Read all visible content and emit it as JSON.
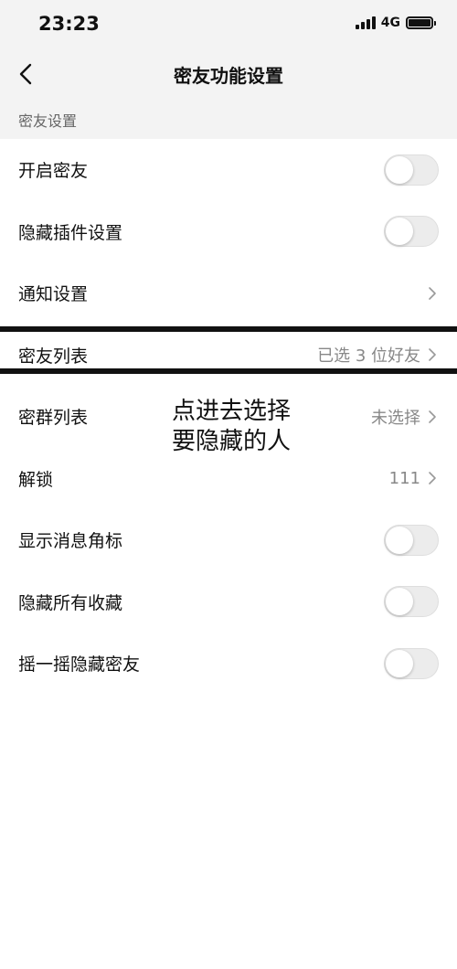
{
  "status_bar": {
    "time": "23:23",
    "network": "4G"
  },
  "nav": {
    "title": "密友功能设置"
  },
  "section": {
    "title": "密友设置"
  },
  "rows": [
    {
      "label": "开启密友",
      "type": "toggle",
      "on": false
    },
    {
      "label": "隐藏插件设置",
      "type": "toggle",
      "on": false
    },
    {
      "label": "通知设置",
      "type": "link",
      "value": ""
    },
    {
      "label": "密友列表",
      "type": "link",
      "value": "已选 3 位好友"
    },
    {
      "label": "密群列表",
      "type": "link",
      "value": "未选择"
    },
    {
      "label": "解锁",
      "type": "link",
      "value": "111"
    },
    {
      "label": "显示消息角标",
      "type": "toggle",
      "on": false
    },
    {
      "label": "隐藏所有收藏",
      "type": "toggle",
      "on": false
    },
    {
      "label": "摇一摇隐藏密友",
      "type": "toggle",
      "on": false
    }
  ],
  "annotation": {
    "line1": "点进去选择",
    "line2": "要隐藏的人"
  }
}
